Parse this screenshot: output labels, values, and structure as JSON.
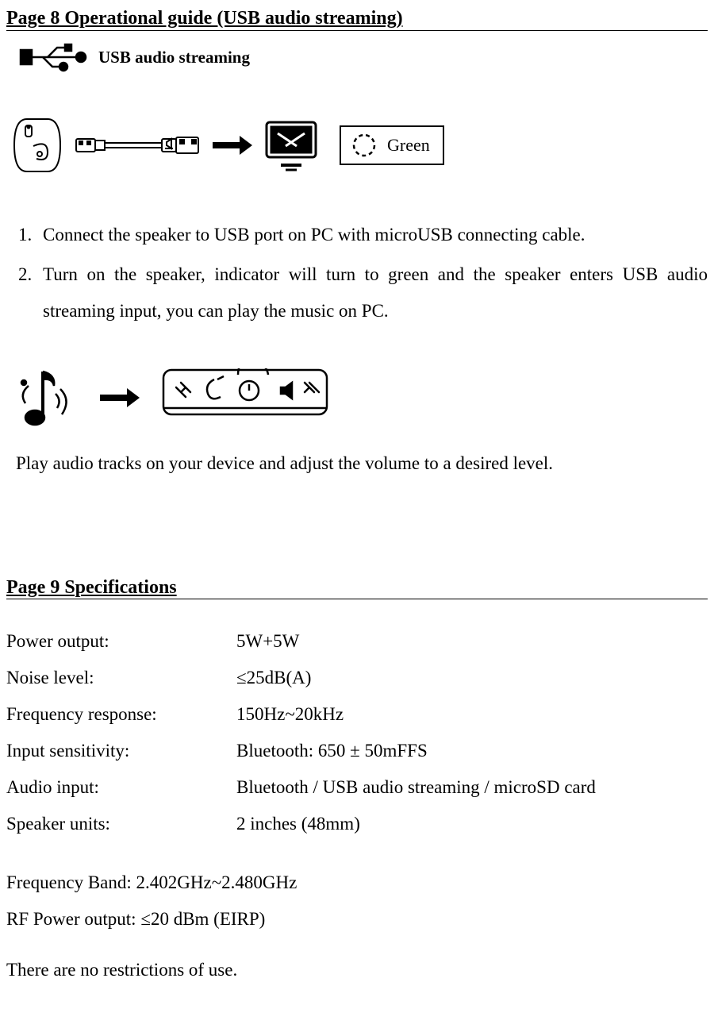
{
  "page8": {
    "title": "Page 8 Operational guide (USB audio streaming)",
    "usbLabel": "USB audio streaming",
    "ledColor": "Green",
    "steps": [
      "Connect the speaker to USB port on PC with microUSB connecting cable.",
      "Turn on the speaker, indicator will turn to green and the speaker enters USB audio streaming input, you can play the music on PC."
    ],
    "playText": "Play audio tracks on your device and adjust the volume to a desired level."
  },
  "page9": {
    "title": "Page 9 Specifications",
    "specs": [
      {
        "label": "Power output:",
        "value": "5W+5W"
      },
      {
        "label": "Noise level:",
        "value": "≤25dB(A)"
      },
      {
        "label": "Frequency response:",
        "value": "150Hz~20kHz"
      },
      {
        "label": "Input sensitivity:",
        "value": "Bluetooth: 650 ± 50mFFS"
      },
      {
        "label": "Audio input:",
        "value": "Bluetooth / USB audio streaming / microSD card"
      },
      {
        "label": "Speaker units:",
        "value": "2 inches (48mm)"
      }
    ],
    "extraSpecs": [
      "Frequency Band: 2.402GHz~2.480GHz",
      "RF Power output: ≤20 dBm (EIRP)"
    ],
    "footnote": "There are no restrictions of use."
  }
}
